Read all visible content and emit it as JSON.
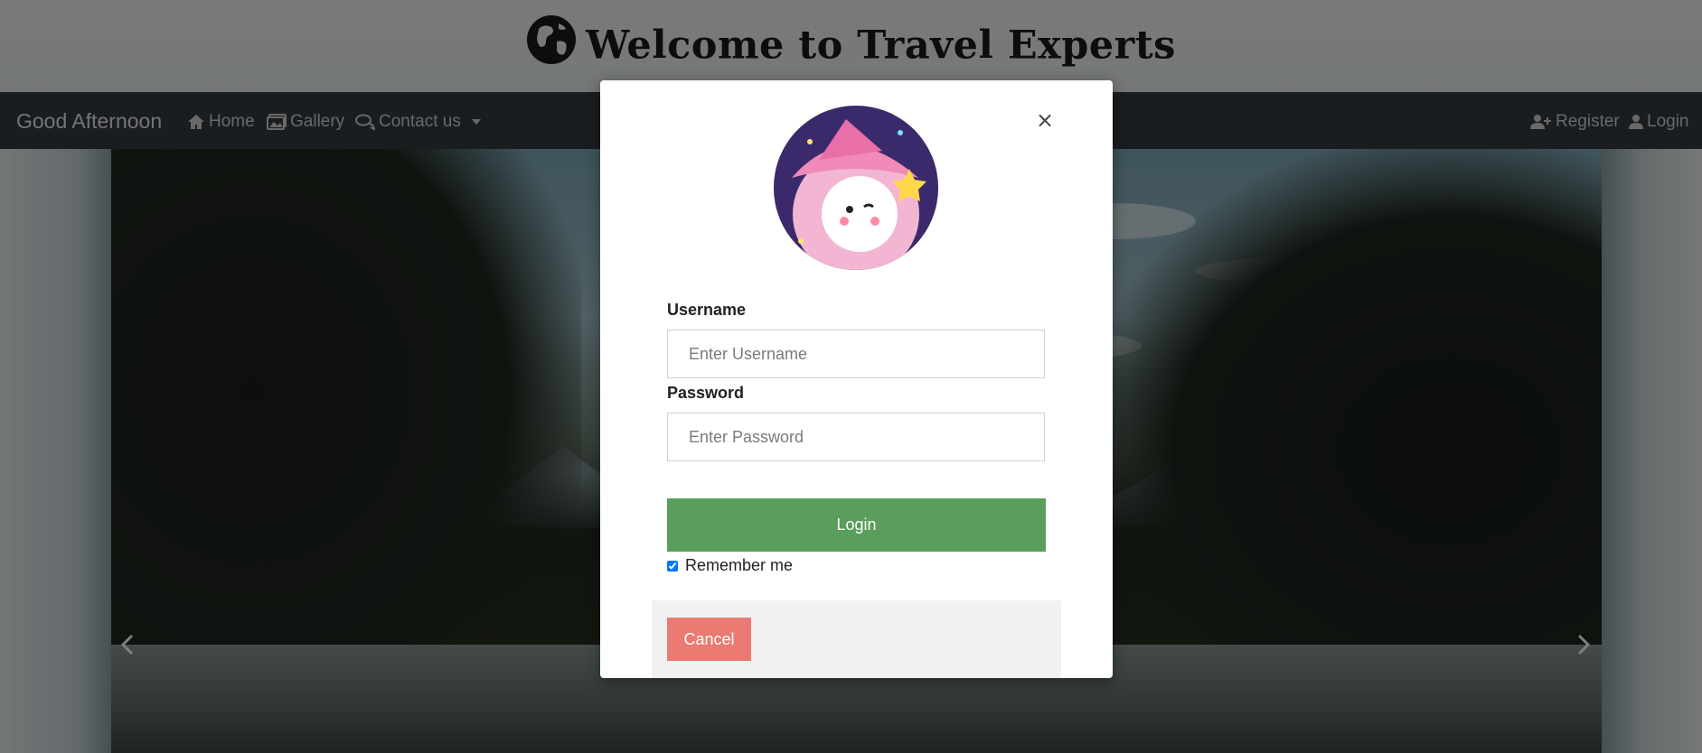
{
  "header": {
    "title": "Welcome to Travel Experts",
    "logo_icon": "globe-icon"
  },
  "navbar": {
    "greeting": "Good Afternoon",
    "links": [
      {
        "label": "Home",
        "icon": "home-icon"
      },
      {
        "label": "Gallery",
        "icon": "images-icon"
      },
      {
        "label": "Contact us",
        "icon": "comments-icon"
      }
    ],
    "right_links": [
      {
        "label": "Register",
        "icon": "user-plus-icon"
      },
      {
        "label": "Login",
        "icon": "user-icon"
      }
    ]
  },
  "modal": {
    "close_label": "×",
    "username_label": "Username",
    "username_placeholder": "Enter Username",
    "username_value": "",
    "password_label": "Password",
    "password_placeholder": "Enter Password",
    "password_value": "",
    "login_button": "Login",
    "remember_label": "Remember me",
    "remember_checked": true,
    "cancel_button": "Cancel"
  },
  "colors": {
    "navbar_bg": "#343a40",
    "login_button": "#5a9e5c",
    "cancel_button": "#ea7a72"
  }
}
